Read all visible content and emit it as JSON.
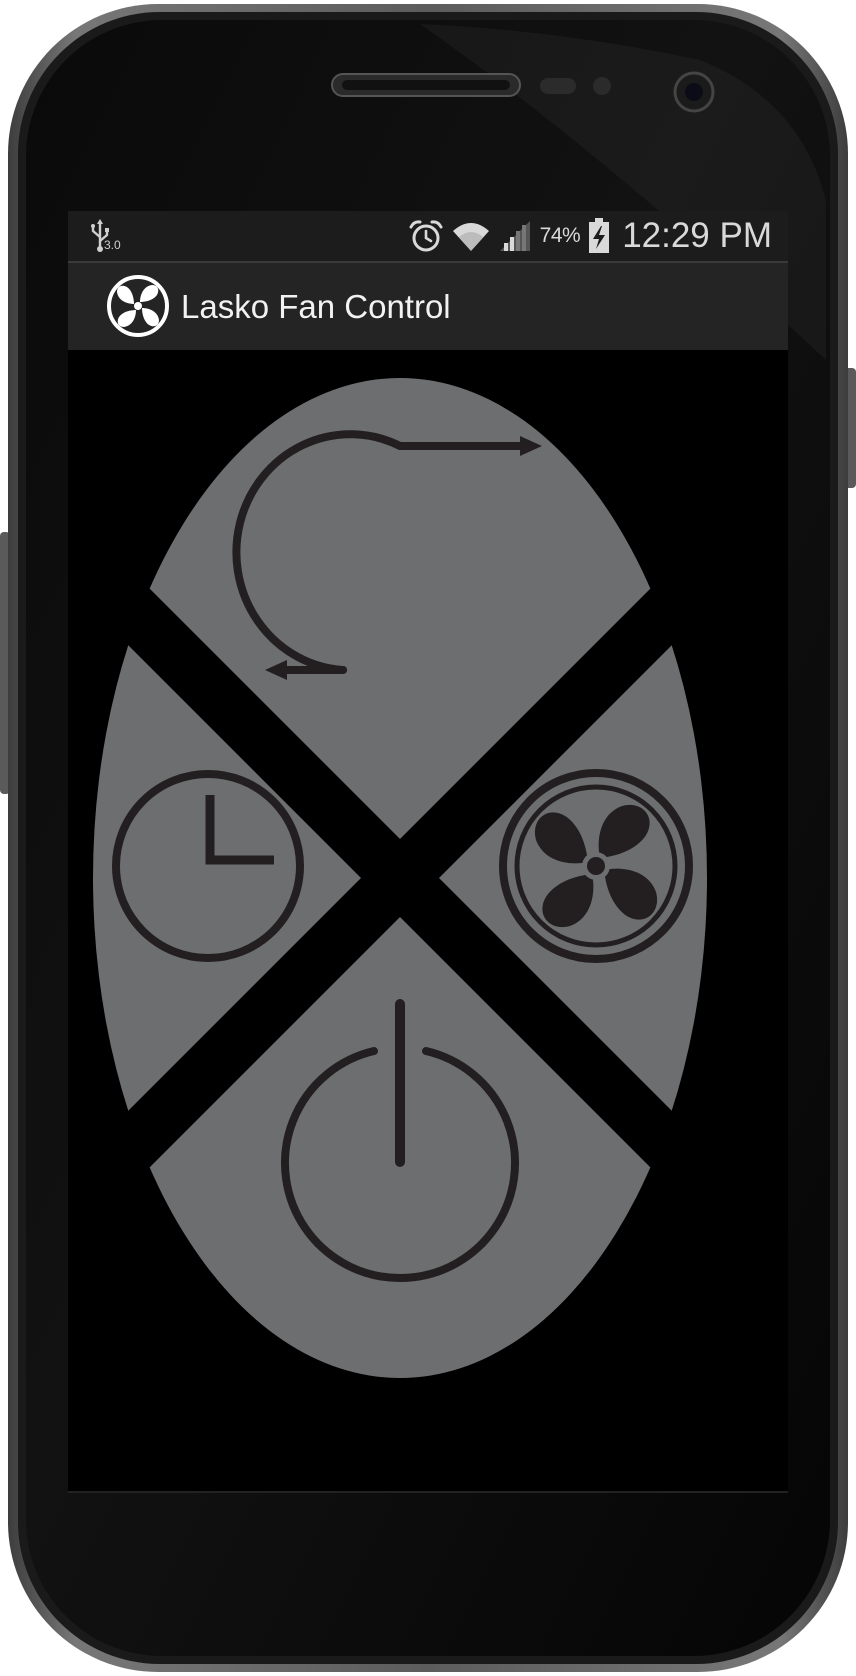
{
  "status_bar": {
    "usb_version": "3.0",
    "battery_percent": "74%",
    "time": "12:29 PM",
    "icons": [
      "usb-icon",
      "alarm-icon",
      "wifi-icon",
      "signal-icon",
      "battery-charging-icon"
    ]
  },
  "action_bar": {
    "title": "Lasko Fan Control",
    "icon": "fan-icon"
  },
  "remote": {
    "buttons": [
      {
        "name": "oscillate-button",
        "icon": "oscillate-icon"
      },
      {
        "name": "timer-button",
        "icon": "clock-icon"
      },
      {
        "name": "speed-button",
        "icon": "fan-icon"
      },
      {
        "name": "power-button",
        "icon": "power-icon"
      }
    ]
  },
  "colors": {
    "screen_background": "#000000",
    "status_bar": "#1c1c1c",
    "action_bar": "#242424",
    "remote_body": "#6d6e70",
    "remote_icons": "#231f20",
    "text": "#f2f2f2"
  }
}
